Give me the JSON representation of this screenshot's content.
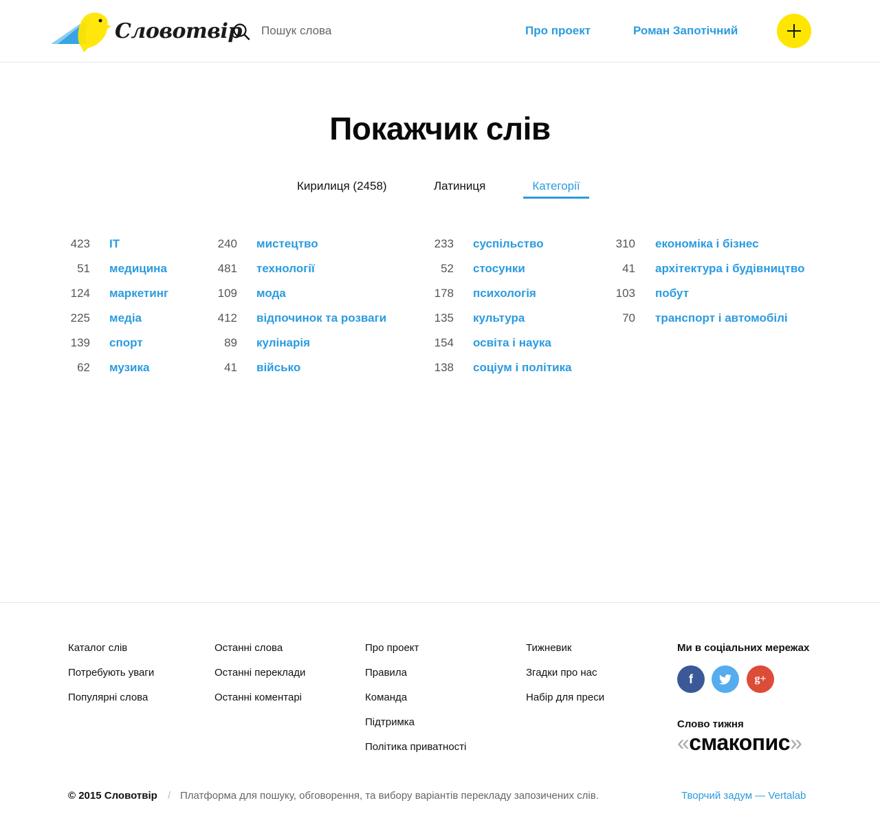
{
  "header": {
    "logo_text": "Словотвір",
    "search_placeholder": "Пошук слова",
    "nav": {
      "about": "Про проект",
      "user": "Роман Запотічний"
    }
  },
  "page_title": "Покажчик слів",
  "tabs": {
    "cyrillic": "Кирилиця (2458)",
    "latin": "Латиниця",
    "categories": "Категорії",
    "active": "categories"
  },
  "categories": {
    "col1": [
      {
        "count": "423",
        "name": "IT"
      },
      {
        "count": "51",
        "name": "медицина"
      },
      {
        "count": "124",
        "name": "маркетинг"
      },
      {
        "count": "225",
        "name": "медіа"
      },
      {
        "count": "139",
        "name": "спорт"
      },
      {
        "count": "62",
        "name": "музика"
      }
    ],
    "col2": [
      {
        "count": "240",
        "name": "мистецтво"
      },
      {
        "count": "481",
        "name": "технології"
      },
      {
        "count": "109",
        "name": "мода"
      },
      {
        "count": "412",
        "name": "відпочинок та розваги"
      },
      {
        "count": "89",
        "name": "кулінарія"
      },
      {
        "count": "41",
        "name": "військо"
      }
    ],
    "col3": [
      {
        "count": "233",
        "name": "суспільство"
      },
      {
        "count": "52",
        "name": "стосунки"
      },
      {
        "count": "178",
        "name": "психологія"
      },
      {
        "count": "135",
        "name": "культура"
      },
      {
        "count": "154",
        "name": "освіта і наука"
      },
      {
        "count": "138",
        "name": "соціум і політика"
      }
    ],
    "col4": [
      {
        "count": "310",
        "name": "економіка і бізнес"
      },
      {
        "count": "41",
        "name": "архітектура і будівництво"
      },
      {
        "count": "103",
        "name": "побут"
      },
      {
        "count": "70",
        "name": "транспорт і автомобілі"
      }
    ]
  },
  "footer": {
    "col1": [
      "Каталог слів",
      "Потребують уваги",
      "Популярні слова"
    ],
    "col2": [
      "Останні слова",
      "Останні переклади",
      "Останні коментарі"
    ],
    "col3": [
      "Про проект",
      "Правила",
      "Команда",
      "Підтримка",
      "Політика приватності"
    ],
    "col4": [
      "Тижневик",
      "Згадки про нас",
      "Набір для преси"
    ],
    "social_title": "Ми в соціальних мережах",
    "social": {
      "facebook": "f",
      "twitter": "twitter-icon",
      "googleplus": "g+"
    },
    "word_of_week_title": "Слово тижня",
    "word_of_week": "смакопис",
    "copyright": "© 2015 Словотвір",
    "separator": "/",
    "tagline": "Платформа для пошуку, обговорення, та вибору варіантів перекладу запозичених слів.",
    "credit": "Творчий задум — Vertalab"
  },
  "colors": {
    "accent": "#2b9be0",
    "add_button": "#ffe600",
    "facebook": "#3b5998",
    "twitter": "#55acee",
    "googleplus": "#dd4b39"
  }
}
